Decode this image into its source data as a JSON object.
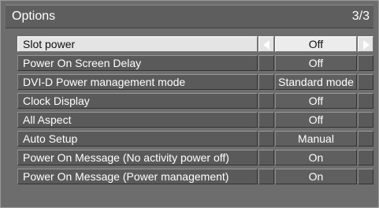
{
  "title": "Options",
  "page_indicator": "3/3",
  "selected_index": 0,
  "rows": [
    {
      "label": "Slot power",
      "value": "Off"
    },
    {
      "label": "Power On Screen Delay",
      "value": "Off"
    },
    {
      "label": "DVI-D Power management mode",
      "value": "Standard mode"
    },
    {
      "label": "Clock Display",
      "value": "Off"
    },
    {
      "label": "All Aspect",
      "value": "Off"
    },
    {
      "label": "Auto Setup",
      "value": "Manual"
    },
    {
      "label": "Power On Message (No activity power off)",
      "value": "On"
    },
    {
      "label": "Power On Message (Power management)",
      "value": "On"
    }
  ],
  "icons": {
    "left": "left-arrow-icon",
    "right": "right-arrow-icon"
  },
  "colors": {
    "background": "#6d6d6d",
    "selected_row": "#e4e4e4",
    "text": "#ffffff",
    "selected_text": "#111111"
  }
}
